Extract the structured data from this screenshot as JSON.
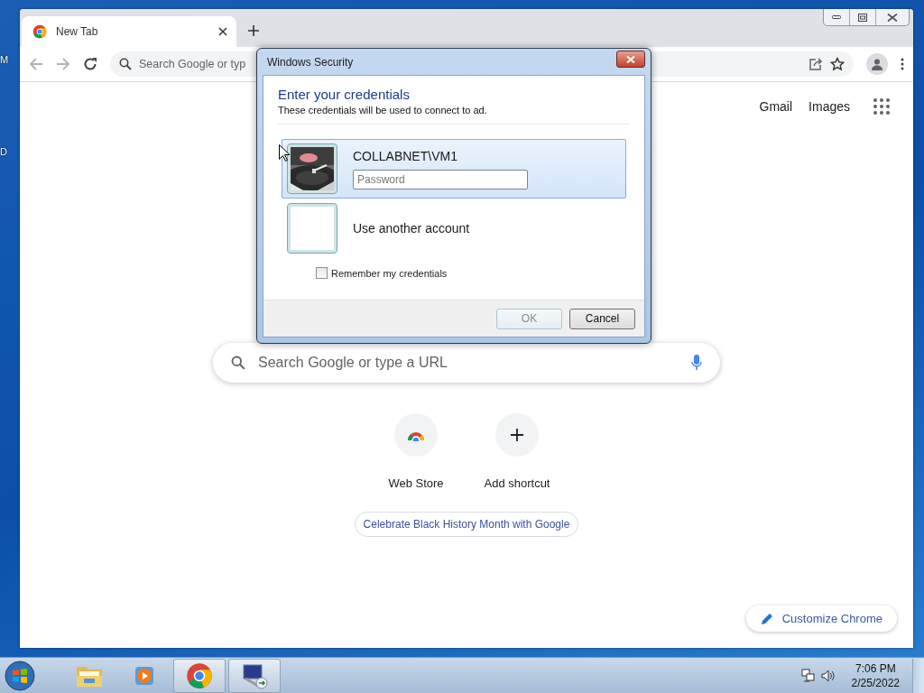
{
  "desktop": {
    "icon_labels": [
      "M",
      "D"
    ]
  },
  "browser": {
    "tabs": [
      {
        "title": "New Tab",
        "selected": true
      }
    ],
    "omnibox": {
      "placeholder": "Search Google or typ"
    },
    "header_links": [
      "Gmail",
      "Images"
    ],
    "search": {
      "placeholder": "Search Google or type a URL"
    },
    "shortcuts": [
      {
        "label": "Web Store",
        "kind": "webstore"
      },
      {
        "label": "Add shortcut",
        "kind": "add"
      }
    ],
    "promo": "Celebrate Black History Month with Google",
    "customize_button": "Customize Chrome"
  },
  "dialog": {
    "title": "Windows Security",
    "heading": "Enter your credentials",
    "subtitle": "These credentials will be used to connect to ad.",
    "accounts": [
      {
        "kind": "user",
        "name": "COLLABNET\\VM1",
        "selected": true,
        "password_placeholder": "Password"
      },
      {
        "kind": "other",
        "name": "Use another account",
        "selected": false
      }
    ],
    "remember": {
      "label": "Remember my credentials",
      "checked": false
    },
    "buttons": [
      {
        "label": "OK",
        "disabled": true
      },
      {
        "label": "Cancel",
        "disabled": false
      }
    ]
  },
  "taskbar": {
    "apps": [
      {
        "kind": "explorer",
        "active": false
      },
      {
        "kind": "media",
        "active": false
      },
      {
        "kind": "chrome",
        "active": true
      },
      {
        "kind": "remote",
        "active": true
      }
    ],
    "clock": {
      "time": "7:06 PM",
      "date": "2/25/2022"
    }
  }
}
